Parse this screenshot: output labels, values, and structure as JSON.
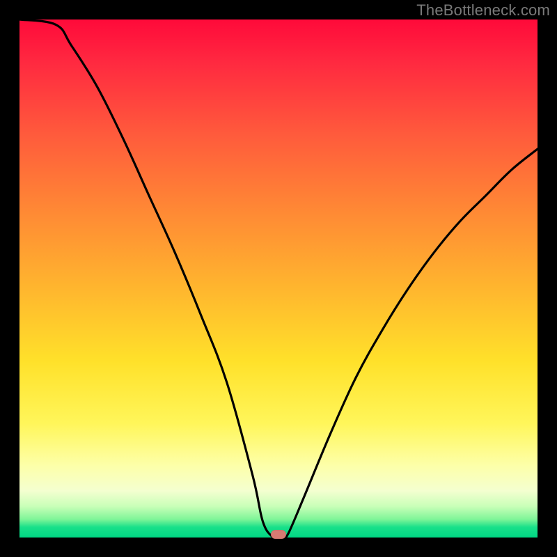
{
  "watermark": "TheBottleneck.com",
  "colors": {
    "background": "#000000",
    "gradient_top": "#ff0a3a",
    "gradient_mid1": "#ff8c34",
    "gradient_mid2": "#ffe12a",
    "gradient_low": "#fdffa8",
    "gradient_bottom": "#00d884",
    "curve": "#000000",
    "marker": "#d67a72",
    "watermark_text": "#7a7a7a"
  },
  "chart_data": {
    "type": "line",
    "title": "",
    "xlabel": "",
    "ylabel": "",
    "xlim": [
      0,
      100
    ],
    "ylim": [
      0,
      100
    ],
    "grid": false,
    "legend": false,
    "series": [
      {
        "name": "bottleneck-curve",
        "x": [
          0,
          7,
          10,
          15,
          20,
          25,
          30,
          35,
          40,
          45,
          47,
          49,
          50,
          51,
          52,
          55,
          60,
          65,
          70,
          75,
          80,
          85,
          90,
          95,
          100
        ],
        "values": [
          100,
          99,
          95,
          87,
          77,
          66,
          55,
          43,
          30,
          12,
          3,
          0,
          0,
          0,
          1,
          8,
          20,
          31,
          40,
          48,
          55,
          61,
          66,
          71,
          75
        ]
      }
    ],
    "marker": {
      "x": 50,
      "y": 0
    },
    "notes": "V-shaped black curve on red-to-green vertical gradient; minimum at ~x=50 touching bottom; small rounded marker near the minimum."
  }
}
